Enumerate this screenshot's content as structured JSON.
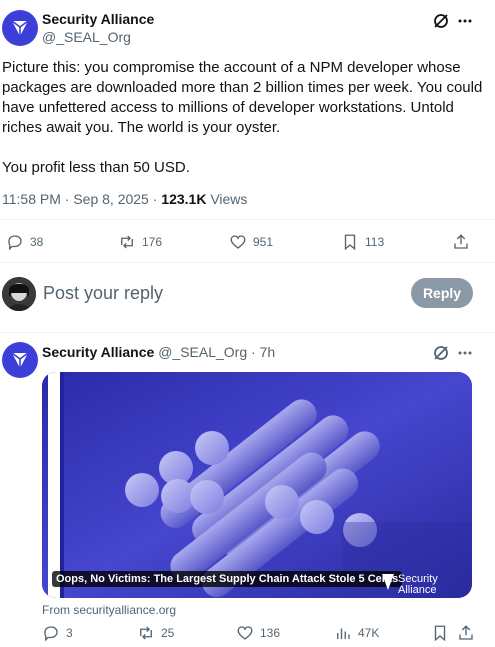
{
  "main_tweet": {
    "author_name": "Security Alliance",
    "author_handle": "@_SEAL_Org",
    "text_para1": "Picture this: you compromise the account of a NPM developer whose packages are downloaded more than 2 billion times per week. You could have unfettered access to millions of developer workstations. Untold riches await you. The world is your oyster.",
    "text_para2": "You profit less than 50 USD.",
    "time": "11:58 PM · Sep 8, 2025 · ",
    "views_count": "123.1K",
    "views_label": " Views",
    "replies": "38",
    "reposts": "176",
    "likes": "951",
    "bookmarks": "113"
  },
  "reply_box": {
    "placeholder": "Post your reply",
    "button_label": "Reply"
  },
  "second_tweet": {
    "author_name": "Security Alliance",
    "author_handle": "@_SEAL_Org",
    "time": "· 7h",
    "card_caption": "Oops, No Victims: The Largest Supply Chain Attack Stole 5 Cents",
    "card_logo_text_1": "Security",
    "card_logo_text_2": "Alliance",
    "card_source": "From securityalliance.org",
    "replies": "3",
    "reposts": "25",
    "likes": "136",
    "views": "47K"
  },
  "colors": {
    "brand": "#3b3fd8",
    "reply_button_disabled": "#8b98a5"
  }
}
